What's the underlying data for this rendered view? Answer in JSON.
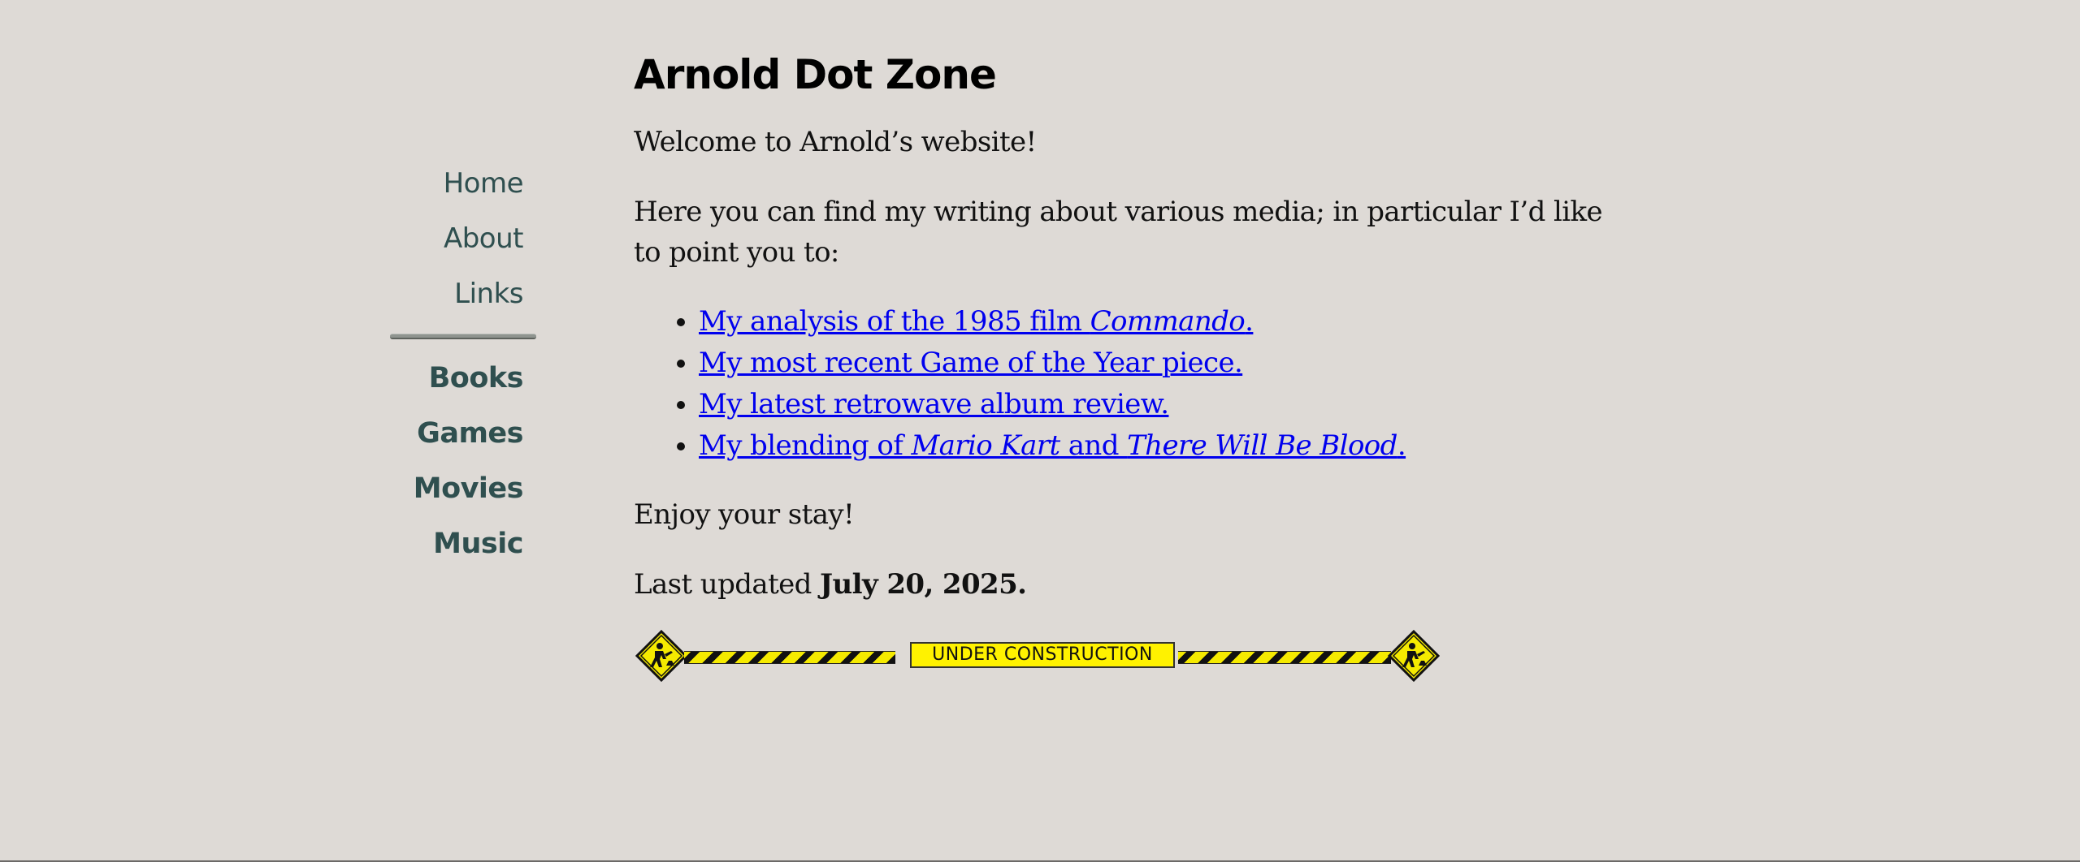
{
  "site": {
    "title": "Arnold Dot Zone"
  },
  "nav": {
    "items": [
      {
        "label": "Home"
      },
      {
        "label": "About"
      },
      {
        "label": "Links"
      }
    ],
    "sections": [
      {
        "label": "Books"
      },
      {
        "label": "Games"
      },
      {
        "label": "Movies"
      },
      {
        "label": "Music"
      }
    ]
  },
  "main": {
    "welcome": "Welcome to Arnold’s website!",
    "intro": "Here you can find my writing about various media; in particular I’d like to point you to:",
    "links": [
      {
        "pre": "My analysis of the 1985 film ",
        "em": "Commando",
        "post": "."
      },
      {
        "text": "My most recent Game of the Year piece."
      },
      {
        "text": "My latest retrowave album review."
      },
      {
        "pre": "My blending of ",
        "em1": "Mario Kart",
        "mid": " and ",
        "em2": "There Will Be Blood",
        "post": "."
      }
    ],
    "enjoy": "Enjoy your stay!",
    "updated_prefix": "Last updated ",
    "updated_date": "July 20, 2025.",
    "banner_text": "UNDER CONSTRUCTION"
  },
  "colors": {
    "background": "#dedad6",
    "nav_text": "#2f4f4f",
    "link": "#0000ee",
    "construction_yellow": "#fff200"
  },
  "icons": {
    "left_sign": "construction-worker-icon",
    "right_sign": "construction-worker-icon"
  }
}
